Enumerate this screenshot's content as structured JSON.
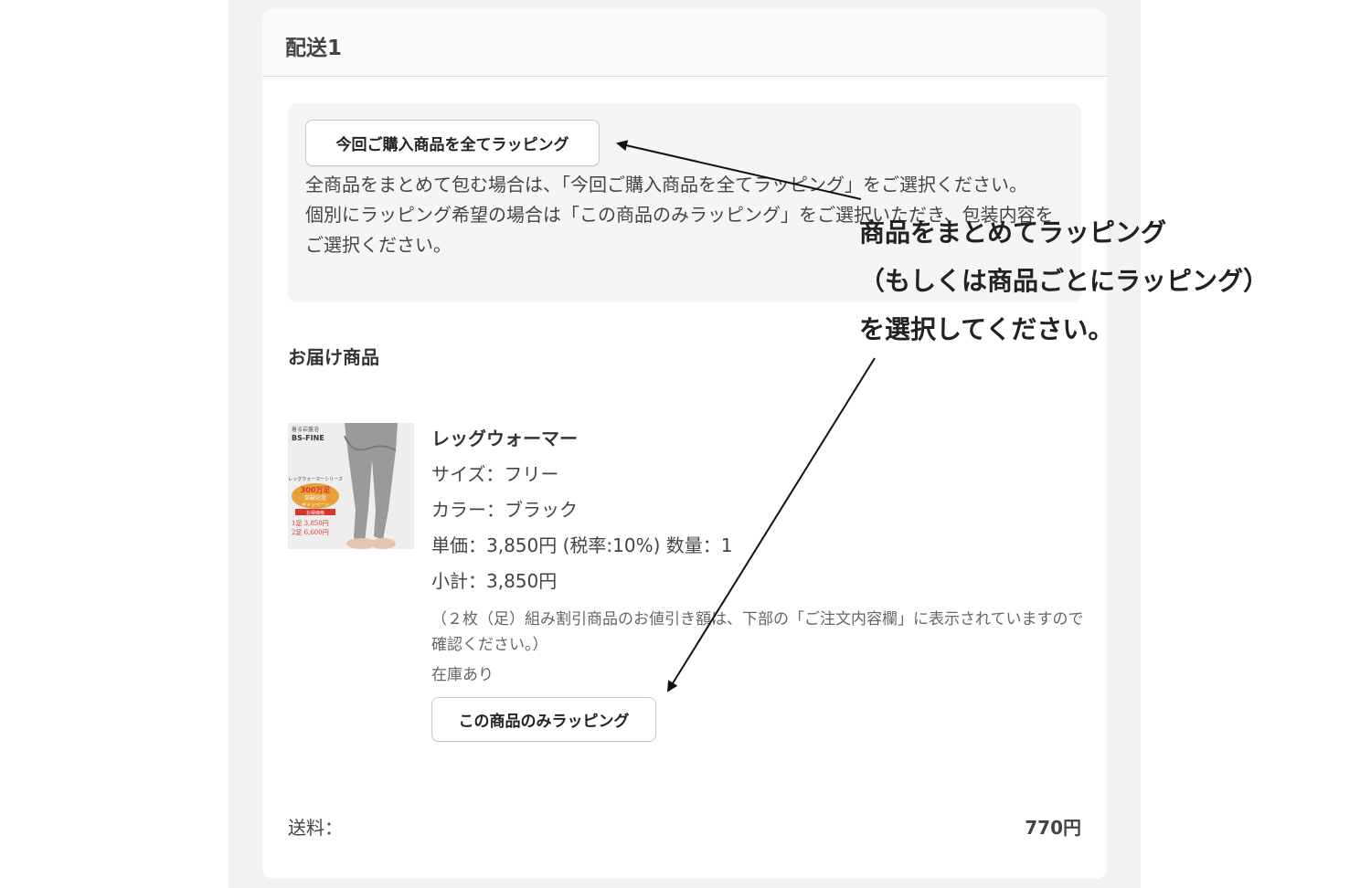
{
  "delivery": {
    "title": "配送1",
    "wrap_all_button": "今回ご購入商品を全てラッピング",
    "wrap_description": [
      "全商品をまとめて包む場合は、「今回ご購入商品を全てラッピング」をご選択ください。",
      "個別にラッピング希望の場合は「この商品のみラッピング」をご選択いただき、包装内容をご選択ください。"
    ],
    "items_heading": "お届け商品",
    "product": {
      "name": "レッグウォーマー",
      "size": "サイズ：フリー",
      "color": "カラー：ブラック",
      "price_qty": "単価：3,850円 (税率:10%) 数量：1",
      "subtotal": "小計：3,850円",
      "note": "（２枚（足）組み割引商品のお値引き額は、下部の「ご注文内容欄」に表示されていますので確認ください。）",
      "stock": "在庫あり",
      "wrap_one_button": "この商品のみラッピング",
      "thumbnail": {
        "brand_small": "着る岩盤浴",
        "brand": "BS-FINE",
        "series": "レッグウォーマーシリーズ",
        "badge_main": "300万足",
        "badge_sub": "突破記念",
        "badge_campaign": "キャンペーン",
        "ribbon": "お得価格",
        "price_1": "1足 3,850円",
        "price_2": "2足 6,600円"
      }
    },
    "shipping_label": "送料：",
    "shipping_value": "770円"
  },
  "annotation": {
    "lines": [
      "商品をまとめてラッピング",
      "（もしくは商品ごとにラッピング）",
      "を選択してください。"
    ]
  },
  "colors": {
    "page_bg": "#f2f2f2",
    "card_bg": "#ffffff",
    "box_bg": "#f5f5f5",
    "badge_orange": "#e8a13a",
    "badge_red": "#d9362b",
    "arrow": "#111111"
  }
}
